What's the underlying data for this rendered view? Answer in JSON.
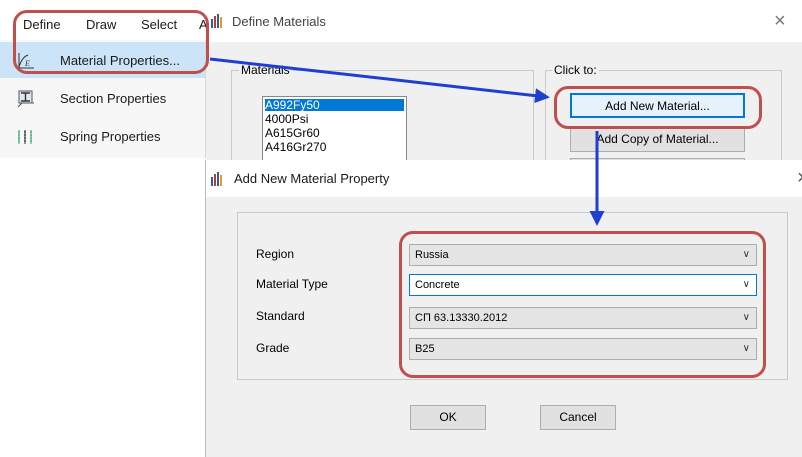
{
  "menubar": {
    "tabs": [
      "Define",
      "Draw",
      "Select",
      "A"
    ]
  },
  "menu": {
    "items": [
      {
        "label": "Material Properties...",
        "icon": "material-properties-icon"
      },
      {
        "label": "Section Properties",
        "icon": "section-properties-icon"
      },
      {
        "label": "Spring Properties",
        "icon": "spring-properties-icon"
      }
    ]
  },
  "define_materials": {
    "title": "Define Materials",
    "close": "×",
    "materials_label": "Materials",
    "click_to_label": "Click to:",
    "materials": [
      "A992Fy50",
      "4000Psi",
      "A615Gr60",
      "A416Gr270"
    ],
    "selected_material": "A992Fy50",
    "add_new_label": "Add New Material...",
    "add_copy_label": "Add Copy of Material..."
  },
  "add_new_material": {
    "title": "Add New Material Property",
    "close": "×",
    "fields": [
      {
        "label": "Region",
        "value": "Russia"
      },
      {
        "label": "Material Type",
        "value": "Concrete"
      },
      {
        "label": "Standard",
        "value": "СП 63.13330.2012"
      },
      {
        "label": "Grade",
        "value": "B25"
      }
    ],
    "ok_label": "OK",
    "cancel_label": "Cancel"
  },
  "colors": {
    "annotation_red": "#c0504d",
    "arrow_blue": "#1f3fd0",
    "selection_blue": "#0078d7",
    "menu_highlight": "#cce4f7"
  }
}
